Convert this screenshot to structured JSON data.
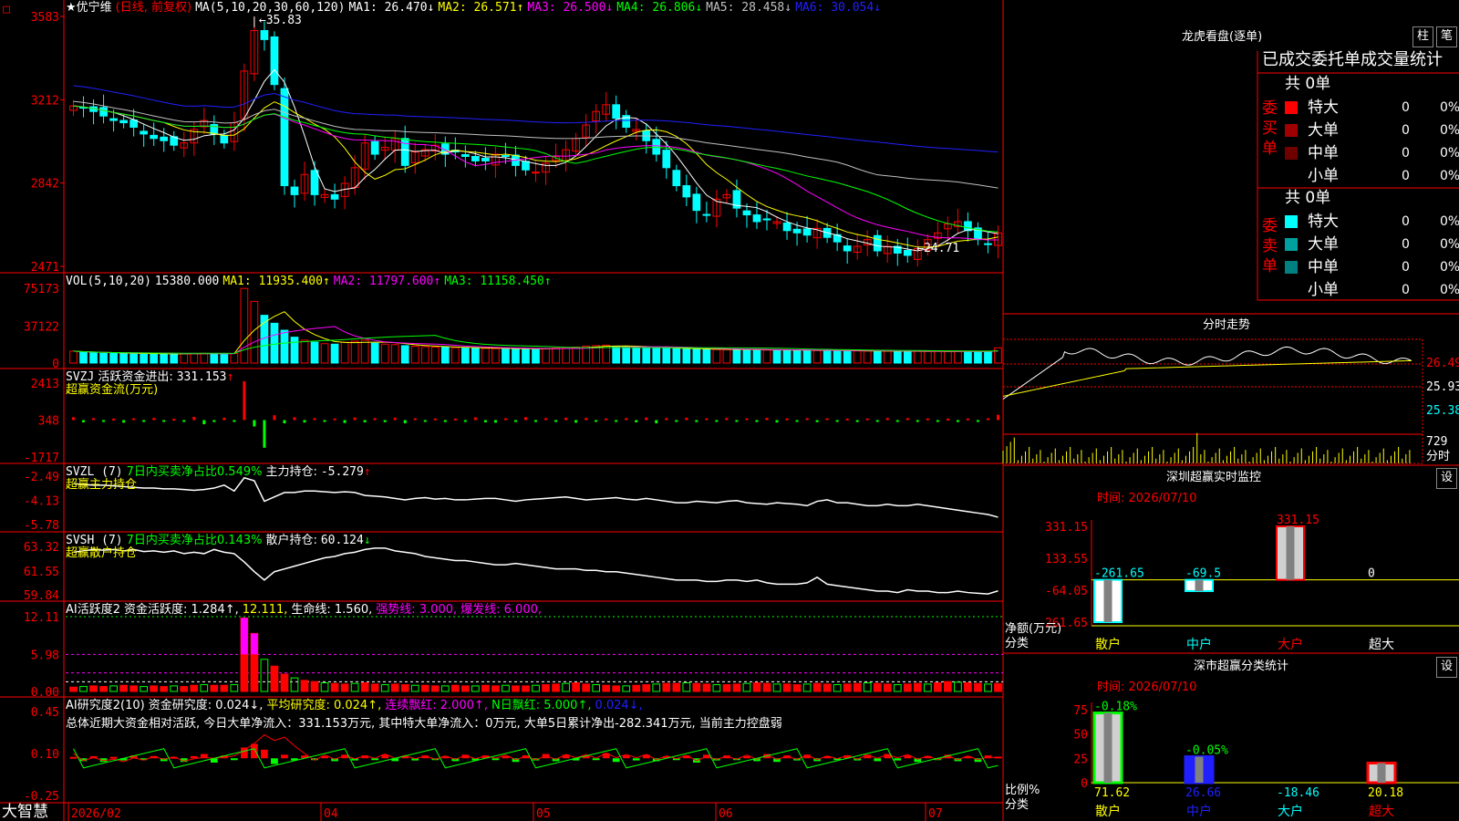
{
  "app": {
    "brand": "大智慧"
  },
  "k_panel": {
    "stock": "优宁维",
    "mode": "(日线, 前复权)",
    "ma_params": "MA(5,10,20,30,60,120)",
    "ma_values": [
      {
        "label": "MA1:",
        "value": "26.470",
        "arrow": "↓",
        "color": "#ffffff"
      },
      {
        "label": "MA2:",
        "value": "26.571",
        "arrow": "↑",
        "color": "#ffff00"
      },
      {
        "label": "MA3:",
        "value": "26.500",
        "arrow": "↓",
        "color": "#ff00ff"
      },
      {
        "label": "MA4:",
        "value": "26.806",
        "arrow": "↓",
        "color": "#00ff00"
      },
      {
        "label": "MA5:",
        "value": "28.458",
        "arrow": "↓",
        "color": "#c0c0c0"
      },
      {
        "label": "MA6:",
        "value": "30.054",
        "arrow": "↓",
        "color": "#2020ff"
      }
    ],
    "y_ticks": [
      "3583",
      "3212",
      "2842",
      "2471"
    ],
    "high_note": "35.83",
    "low_note": "←24.71"
  },
  "vol_panel": {
    "title": "VOL(5,10,20)",
    "value": "15380.000",
    "ma": [
      {
        "label": "MA1:",
        "value": "11935.400",
        "arrow": "↑",
        "color": "#ffff00"
      },
      {
        "label": "MA2:",
        "value": "11797.600",
        "arrow": "↑",
        "color": "#ff00ff"
      },
      {
        "label": "MA3:",
        "value": "11158.450",
        "arrow": "↑",
        "color": "#00ff00"
      }
    ],
    "y_ticks": [
      "75173",
      "37122",
      "0"
    ]
  },
  "svzj_panel": {
    "title": "SVZJ",
    "label": "活跃资金进出:",
    "value": "331.153",
    "arrow": "↑",
    "subtitle": "超赢资金流(万元)",
    "y_ticks": [
      "2413",
      "348",
      "-1717"
    ]
  },
  "svzl_panel": {
    "title": "SVZL (7)",
    "label1": "7日内买卖净占比0.549%",
    "label2": "主力持仓:",
    "value": "-5.279",
    "arrow": "↑",
    "subtitle": "超赢主力持仓",
    "y_ticks": [
      "-2.49",
      "-4.13",
      "-5.78"
    ]
  },
  "svsh_panel": {
    "title": "SVSH (7)",
    "label1": "7日内买卖净占比0.143%",
    "label2": "散户持仓:",
    "value": "60.124",
    "arrow": "↓",
    "subtitle": "超赢散户持仓",
    "y_ticks": [
      "63.32",
      "61.55",
      "59.84"
    ]
  },
  "ai_act_panel": {
    "title": "AI活跃度2",
    "items": [
      {
        "text": "资金活跃度: 1.284",
        "arrow": "↑",
        "color": "#ffffff"
      },
      {
        "text": "12.111",
        "arrow": "",
        "color": "#ffff00"
      },
      {
        "text": "生命线: 1.560",
        "arrow": "",
        "color": "#ffffff"
      },
      {
        "text": "强势线: 3.000",
        "arrow": "",
        "color": "#ff00ff"
      },
      {
        "text": "爆发线: 6.000",
        "arrow": "",
        "color": "#ff00ff"
      }
    ],
    "y_ticks": [
      "12.11",
      "5.98",
      "0.00"
    ]
  },
  "ai_res_panel": {
    "title": "AI研究度2(10)",
    "items": [
      {
        "text": "资金研究度: 0.024",
        "arrow": "↓",
        "color": "#ffffff"
      },
      {
        "text": "平均研究度: 0.024",
        "arrow": "↑",
        "color": "#ffff00"
      },
      {
        "text": "连续飘红: 2.000",
        "arrow": "↑",
        "color": "#ff00ff"
      },
      {
        "text": "N日飘红: 5.000",
        "arrow": "↑",
        "color": "#00ff00"
      },
      {
        "text": "0.024",
        "arrow": "↓",
        "color": "#2020ff"
      }
    ],
    "summary": "总体近期大资金相对活跃, 今日大单净流入：331.153万元, 其中特大单净流入：0万元, 大单5日累计净出-282.341万元, 当前主力控盘弱",
    "y_ticks": [
      "0.45",
      "0.10",
      "-0.25"
    ]
  },
  "x_axis": [
    "2026/02",
    "04",
    "05",
    "06",
    "07"
  ],
  "longhu": {
    "title": "龙虎看盘(逐单)",
    "tabs": [
      "柱",
      "笔"
    ],
    "header": "已成交委托单成交量统计",
    "buy_side": "委买单",
    "sell_side": "委卖单",
    "buy_total": "共 0单",
    "sell_total": "共 0单",
    "buy_rows": [
      {
        "label": "特大",
        "count": "0",
        "pct": "0%",
        "color": "#ff0000"
      },
      {
        "label": "大单",
        "count": "0",
        "pct": "0%",
        "color": "#a00000"
      },
      {
        "label": "中单",
        "count": "0",
        "pct": "0%",
        "color": "#700000"
      },
      {
        "label": "小单",
        "count": "0",
        "pct": "0%",
        "color": ""
      }
    ],
    "sell_rows": [
      {
        "label": "特大",
        "count": "0",
        "pct": "0%",
        "color": "#00ffff"
      },
      {
        "label": "大单",
        "count": "0",
        "pct": "0%",
        "color": "#00a0a0"
      },
      {
        "label": "中单",
        "count": "0",
        "pct": "0%",
        "color": "#008080"
      },
      {
        "label": "小单",
        "count": "0",
        "pct": "0%",
        "color": ""
      }
    ]
  },
  "fenshi": {
    "title": "分时走势",
    "y_ticks": [
      "26.49",
      "25.93",
      "25.38"
    ],
    "vol_tick": "729",
    "vol_label": "分时"
  },
  "monitor": {
    "title": "深圳超赢实时监控",
    "btn": "设",
    "time": "时间: 2026/07/10",
    "y_ticks": [
      "331.15",
      "133.55",
      "-64.05",
      "-261.65"
    ],
    "ylabel": "净额(万元)",
    "xlabel": "分类",
    "categories": [
      "散户",
      "中户",
      "大户",
      "超大"
    ],
    "values": [
      -261.65,
      -69.5,
      331.15,
      0
    ],
    "value_labels": [
      "-261.65",
      "-69.5",
      "331.15",
      "0"
    ]
  },
  "classify": {
    "title": "深市超赢分类统计",
    "btn": "设",
    "time": "时间: 2026/07/10",
    "y_ticks": [
      "75",
      "50",
      "25",
      "0"
    ],
    "ylabel": "比例%",
    "xlabel": "分类",
    "categories": [
      "散户",
      "中户",
      "大户",
      "超大"
    ],
    "values": [
      71.62,
      26.66,
      18.46,
      20.18
    ],
    "change_labels": [
      "-0.18%",
      "-0.05%",
      "",
      ""
    ],
    "bottom_labels": [
      "71.62",
      "26.66",
      "-18.46",
      "20.18"
    ]
  },
  "chart_data": [
    {
      "type": "candlestick",
      "title": "优宁维 (日线, 前复权)",
      "y_range": [
        24.71,
        35.83
      ],
      "closes": [
        31.85,
        31.75,
        31.6,
        31.4,
        31.2,
        31.1,
        30.9,
        30.6,
        30.4,
        30.3,
        30.1,
        30.2,
        30.8,
        31.2,
        30.6,
        30.2,
        31.1,
        33.4,
        35.2,
        34.8,
        32.8,
        28.3,
        27.9,
        28.8,
        27.9,
        27.9,
        27.7,
        28.4,
        29.1,
        30.2,
        29.7,
        30.0,
        30.4,
        29.2,
        29.8,
        29.9,
        30.1,
        29.7,
        29.8,
        29.6,
        29.4,
        29.4,
        29.7,
        29.6,
        29.2,
        29.0,
        28.9,
        29.3,
        29.6,
        29.9,
        30.4,
        31.0,
        31.6,
        31.9,
        31.3,
        30.9,
        30.8,
        30.3,
        29.7,
        29.1,
        28.3,
        27.8,
        27.2,
        27.0,
        27.7,
        27.9,
        27.3,
        27.0,
        26.7,
        26.8,
        26.7,
        26.3,
        26.2,
        26.1,
        26.4,
        26.0,
        25.8,
        25.4,
        25.6,
        25.9,
        25.4,
        25.6,
        25.3,
        25.2,
        25.5,
        25.9,
        26.2,
        26.6,
        26.7,
        26.3,
        25.9,
        25.7,
        26.2
      ],
      "ma_series": [
        {
          "name": "MA1",
          "color": "#ffffff"
        },
        {
          "name": "MA2",
          "color": "#ffff00"
        },
        {
          "name": "MA3",
          "color": "#ff00ff"
        },
        {
          "name": "MA4",
          "color": "#00ff00"
        },
        {
          "name": "MA5",
          "color": "#c0c0c0"
        },
        {
          "name": "MA6",
          "color": "#2020ff"
        }
      ]
    },
    {
      "type": "bar",
      "title": "VOL(5,10,20)",
      "y_range": [
        0,
        75173
      ],
      "values": [
        12000,
        11000,
        10500,
        9800,
        9600,
        9700,
        9500,
        9400,
        9300,
        9200,
        9200,
        9400,
        9600,
        9800,
        9500,
        9400,
        9600,
        75000,
        62000,
        48000,
        40000,
        33000,
        26000,
        23000,
        21000,
        19500,
        19000,
        21000,
        22000,
        23000,
        20000,
        19000,
        18500,
        17500,
        17000,
        16500,
        16000,
        16000,
        15500,
        15000,
        15000,
        14800,
        14500,
        14400,
        14300,
        14200,
        14000,
        14500,
        15000,
        15500,
        16000,
        17000,
        17500,
        18000,
        17000,
        16500,
        16000,
        15500,
        15000,
        14800,
        14500,
        14200,
        14000,
        13800,
        13600,
        13500,
        13400,
        13300,
        13200,
        13100,
        13000,
        12900,
        12800,
        12700,
        12600,
        12500,
        12400,
        12300,
        12200,
        12100,
        12000,
        11900,
        11900,
        11800,
        11800,
        11700,
        11700,
        11600,
        11600,
        11600,
        11500,
        11500,
        15380
      ]
    },
    {
      "type": "bar",
      "title": "SVZJ 活跃资金进出",
      "y_range": [
        -1717,
        2413
      ],
      "values": [
        180,
        -140,
        120,
        -100,
        90,
        -160,
        110,
        -90,
        130,
        -110,
        80,
        -80,
        200,
        -260,
        -120,
        150,
        -90,
        2413,
        -400,
        -1717,
        300,
        -200,
        180,
        -150,
        120,
        -110,
        100,
        -180,
        160,
        -140,
        120,
        -130,
        150,
        -200,
        110,
        -90,
        100,
        -120,
        90,
        -80,
        170,
        -140,
        -160,
        110,
        -90,
        180,
        -100,
        120,
        -80,
        140,
        -160,
        130,
        -110,
        100,
        -90,
        120,
        -140,
        160,
        -200,
        120,
        -100,
        150,
        -120,
        110,
        -90,
        130,
        -80,
        110,
        -120,
        140,
        -150,
        100,
        -90,
        120,
        -130,
        110,
        -100,
        90,
        -120,
        100,
        -110,
        130,
        -80,
        120,
        -90,
        100,
        -110,
        90,
        -120,
        100,
        -80,
        110,
        331
      ]
    },
    {
      "type": "line",
      "title": "SVZL 主力持仓",
      "y_range": [
        -5.78,
        -2.49
      ],
      "values": [
        -3.0,
        -3.05,
        -3.1,
        -3.1,
        -3.15,
        -3.2,
        -3.25,
        -3.3,
        -3.3,
        -3.35,
        -3.35,
        -3.4,
        -3.45,
        -3.4,
        -3.3,
        -3.1,
        -3.5,
        -2.6,
        -2.8,
        -4.2,
        -3.9,
        -3.6,
        -3.6,
        -3.5,
        -3.5,
        -3.55,
        -3.6,
        -3.55,
        -3.6,
        -3.8,
        -3.85,
        -3.9,
        -4.0,
        -4.1,
        -4.0,
        -3.95,
        -4.05,
        -4.0,
        -4.1,
        -4.1,
        -4.05,
        -4.0,
        -4.0,
        -4.1,
        -4.2,
        -4.1,
        -4.05,
        -4.0,
        -3.95,
        -3.9,
        -4.0,
        -4.1,
        -4.05,
        -4.0,
        -3.95,
        -4.05,
        -4.1,
        -4.0,
        -4.1,
        -4.2,
        -4.3,
        -4.3,
        -4.2,
        -4.25,
        -4.3,
        -4.2,
        -4.15,
        -4.3,
        -4.35,
        -4.4,
        -4.3,
        -4.35,
        -4.4,
        -4.5,
        -4.2,
        -4.1,
        -4.3,
        -4.3,
        -4.4,
        -4.5,
        -4.5,
        -4.4,
        -4.5,
        -4.5,
        -4.4,
        -4.5,
        -4.6,
        -4.7,
        -4.8,
        -4.9,
        -5.0,
        -5.1,
        -5.28
      ]
    },
    {
      "type": "line",
      "title": "SVSH 散户持仓",
      "y_range": [
        59.84,
        63.32
      ],
      "values": [
        62.9,
        63.0,
        63.1,
        63.05,
        63.1,
        63.0,
        63.1,
        62.95,
        63.0,
        62.9,
        63.0,
        62.8,
        62.9,
        62.8,
        63.1,
        62.9,
        62.8,
        62.2,
        61.5,
        60.9,
        61.5,
        61.7,
        61.9,
        62.1,
        62.3,
        62.5,
        62.6,
        62.8,
        62.9,
        63.1,
        63.2,
        63.2,
        63.0,
        62.9,
        62.8,
        62.6,
        62.5,
        62.4,
        62.3,
        62.3,
        62.2,
        62.1,
        62.0,
        62.0,
        62.1,
        62.0,
        61.9,
        61.8,
        61.7,
        61.7,
        61.7,
        61.6,
        61.6,
        61.5,
        61.5,
        61.4,
        61.3,
        61.2,
        61.1,
        61.0,
        60.9,
        60.9,
        60.9,
        60.8,
        60.8,
        60.9,
        60.9,
        60.8,
        60.9,
        60.7,
        60.6,
        60.6,
        60.6,
        60.7,
        61.1,
        60.6,
        60.5,
        60.4,
        60.3,
        60.2,
        60.1,
        60.1,
        60.0,
        60.2,
        60.1,
        60.1,
        60.0,
        60.0,
        60.1,
        60.0,
        59.95,
        59.9,
        60.12
      ]
    },
    {
      "type": "bar",
      "title": "AI活跃度2",
      "y_range": [
        0,
        12.11
      ],
      "values": [
        0.7,
        0.8,
        0.9,
        0.8,
        0.9,
        1.0,
        0.9,
        0.8,
        0.9,
        0.8,
        0.9,
        0.8,
        1.0,
        1.1,
        1.0,
        1.0,
        1.1,
        11.9,
        9.4,
        5.2,
        4.1,
        2.8,
        2.2,
        1.8,
        1.6,
        1.4,
        1.3,
        1.2,
        1.3,
        1.4,
        1.2,
        1.1,
        1.2,
        1.1,
        1.0,
        1.0,
        0.9,
        0.9,
        1.0,
        0.9,
        0.9,
        1.0,
        0.9,
        1.0,
        0.9,
        0.9,
        1.0,
        1.1,
        1.2,
        1.3,
        1.4,
        1.2,
        1.1,
        1.0,
        0.9,
        0.9,
        1.0,
        1.1,
        1.2,
        1.3,
        1.3,
        1.4,
        1.3,
        1.2,
        1.1,
        1.1,
        1.2,
        1.3,
        1.4,
        1.3,
        1.2,
        1.2,
        1.1,
        1.2,
        1.3,
        1.2,
        1.1,
        1.2,
        1.3,
        1.4,
        1.3,
        1.2,
        1.1,
        1.2,
        1.3,
        1.2,
        1.4,
        1.6,
        1.5,
        1.4,
        1.3,
        1.2,
        1.28
      ]
    },
    {
      "type": "bar",
      "title": "AI研究度2(10)",
      "y_range": [
        -0.25,
        0.45
      ],
      "values": [
        0.02,
        -0.04,
        0.03,
        -0.05,
        0.02,
        -0.03,
        0.04,
        -0.02,
        0.03,
        -0.04,
        0.02,
        -0.05,
        0.03,
        0.06,
        -0.06,
        0.04,
        -0.02,
        0.15,
        0.2,
        0.12,
        -0.08,
        0.05,
        -0.03,
        0.04,
        -0.02,
        0.03,
        -0.04,
        0.05,
        -0.03,
        0.04,
        -0.02,
        0.05,
        -0.04,
        0.03,
        -0.03,
        0.04,
        -0.02,
        0.03,
        -0.04,
        0.05,
        -0.03,
        0.04,
        -0.02,
        0.03,
        -0.05,
        0.04,
        -0.03,
        0.06,
        -0.04,
        0.05,
        -0.03,
        0.04,
        -0.02,
        0.07,
        -0.05,
        0.04,
        -0.03,
        0.05,
        -0.04,
        0.03,
        -0.02,
        0.04,
        -0.06,
        0.05,
        -0.03,
        0.04,
        -0.02,
        0.03,
        -0.04,
        0.06,
        -0.05,
        0.04,
        -0.03,
        0.05,
        -0.04,
        0.03,
        -0.02,
        0.04,
        -0.03,
        0.05,
        -0.04,
        0.06,
        -0.03,
        0.04,
        -0.05,
        0.03,
        -0.02,
        0.05,
        -0.04,
        0.03,
        -0.05,
        0.04,
        0.024
      ]
    },
    {
      "type": "line",
      "title": "分时走势",
      "y_range": [
        25.38,
        26.49
      ],
      "series_colors": [
        "#ffffff",
        "#ffff00"
      ]
    },
    {
      "type": "bar",
      "title": "深圳超赢实时监控",
      "categories": [
        "散户",
        "中户",
        "大户",
        "超大"
      ],
      "values": [
        -261.65,
        -69.5,
        331.15,
        0
      ],
      "y_range": [
        -261.65,
        331.15
      ]
    },
    {
      "type": "bar",
      "title": "深市超赢分类统计",
      "categories": [
        "散户",
        "中户",
        "大户",
        "超大"
      ],
      "values": [
        71.62,
        26.66,
        18.46,
        20.18
      ],
      "y_range": [
        0,
        75
      ]
    }
  ]
}
